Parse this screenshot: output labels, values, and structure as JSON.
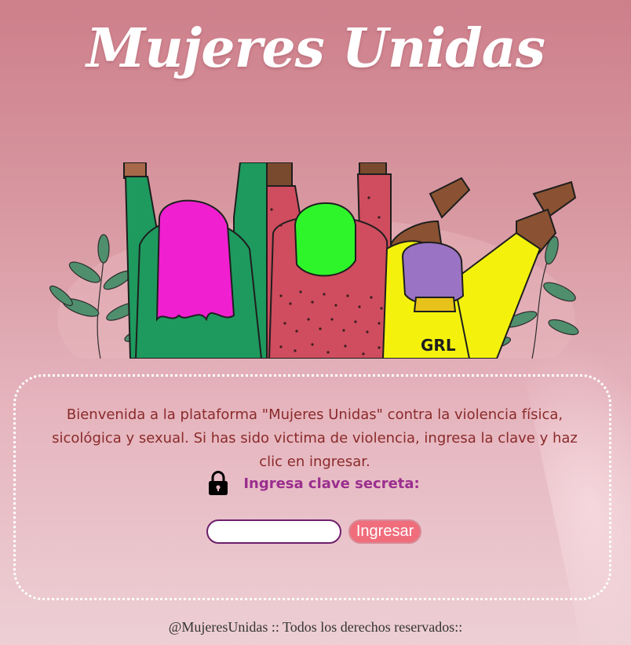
{
  "header": {
    "title": "Mujeres Unidas"
  },
  "hero": {
    "shirt_text": "GRL",
    "icon": "raised-fists-women-illustration"
  },
  "card": {
    "welcome_text": "Bienvenida a la plataforma \"Mujeres Unidas\" contra la violencia física, sicológica y sexual. Si has sido victima de violencia, ingresa la clave y haz clic en ingresar.",
    "lock_icon": "lock-icon",
    "key_label": "Ingresa clave secreta:",
    "input_value": "",
    "submit_label": "Ingresar"
  },
  "footer": {
    "text": "@MujeresUnidas :: Todos los derechos reservados::"
  },
  "colors": {
    "background": "#d99aa3",
    "title": "#ffffff",
    "welcome_text": "#8a2a2a",
    "key_label": "#9a2e8e",
    "button": "#f06d7b",
    "input_border": "#6e1f6b"
  }
}
